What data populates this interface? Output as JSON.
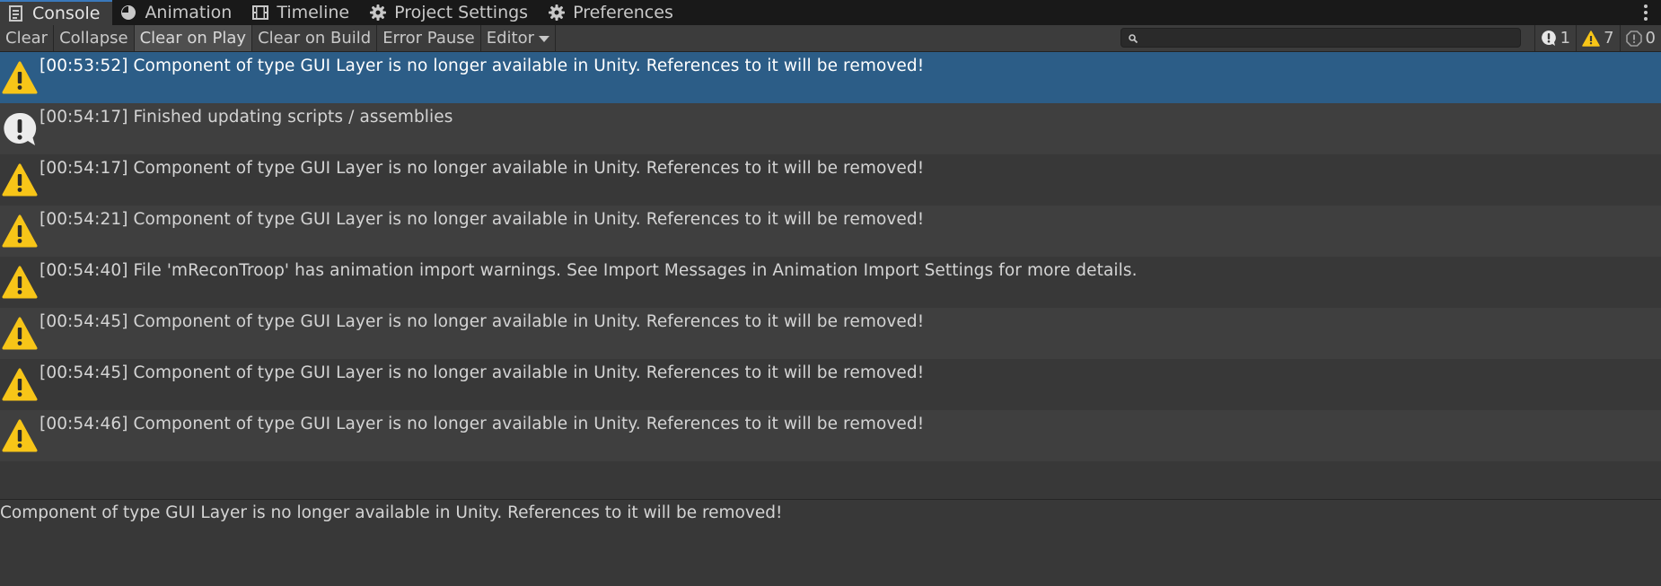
{
  "tabs": [
    {
      "label": "Console",
      "icon": "console-icon",
      "active": true
    },
    {
      "label": "Animation",
      "icon": "animation-clock-icon",
      "active": false
    },
    {
      "label": "Timeline",
      "icon": "film-strip-icon",
      "active": false
    },
    {
      "label": "Project Settings",
      "icon": "gear-icon",
      "active": false
    },
    {
      "label": "Preferences",
      "icon": "gear-icon",
      "active": false
    }
  ],
  "toolbar": {
    "clear": "Clear",
    "collapse": "Collapse",
    "clear_on_play": "Clear on Play",
    "clear_on_build": "Clear on Build",
    "error_pause": "Error Pause",
    "editor": "Editor",
    "search_value": "",
    "search_placeholder": "",
    "counts": {
      "log": "1",
      "warning": "7",
      "error": "0"
    }
  },
  "logs": [
    {
      "type": "warning",
      "text": "[00:53:52] Component of type GUI Layer is no longer available in Unity. References to it will be removed!",
      "selected": true
    },
    {
      "type": "log",
      "text": "[00:54:17] Finished updating scripts / assemblies",
      "selected": false
    },
    {
      "type": "warning",
      "text": "[00:54:17] Component of type GUI Layer is no longer available in Unity. References to it will be removed!",
      "selected": false
    },
    {
      "type": "warning",
      "text": "[00:54:21] Component of type GUI Layer is no longer available in Unity. References to it will be removed!",
      "selected": false
    },
    {
      "type": "warning",
      "text": "[00:54:40] File 'mReconTroop' has animation import warnings. See Import Messages in Animation Import Settings for more details.",
      "selected": false
    },
    {
      "type": "warning",
      "text": "[00:54:45] Component of type GUI Layer is no longer available in Unity. References to it will be removed!",
      "selected": false
    },
    {
      "type": "warning",
      "text": "[00:54:45] Component of type GUI Layer is no longer available in Unity. References to it will be removed!",
      "selected": false
    },
    {
      "type": "warning",
      "text": "[00:54:46] Component of type GUI Layer is no longer available in Unity. References to it will be removed!",
      "selected": false
    }
  ],
  "detail": {
    "text": "Component of type GUI Layer is no longer available in Unity. References to it will be removed!"
  },
  "colors": {
    "selected_row": "#2c5d87",
    "warning": "#f7c518",
    "tab_accent": "#3a79bb"
  }
}
